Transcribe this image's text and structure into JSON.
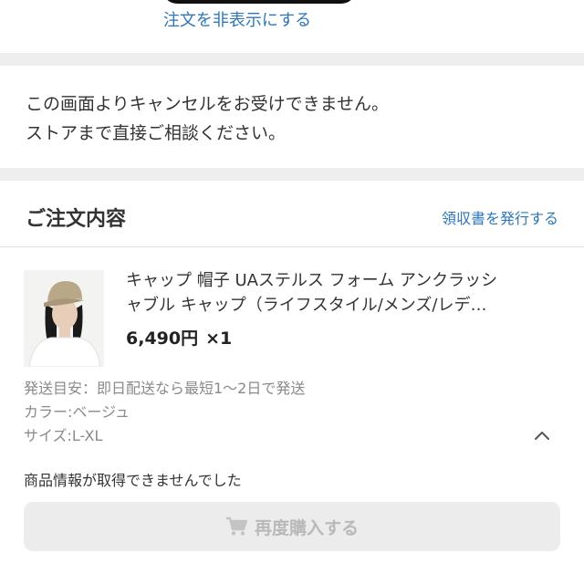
{
  "header": {
    "hide_order_link": "注文を非表示にする"
  },
  "notice": {
    "line1": "この画面よりキャンセルをお受けできません。",
    "line2": "ストアまで直接ご相談ください。"
  },
  "order": {
    "section_title": "ご注文内容",
    "receipt_link": "領収書を発行する",
    "item": {
      "name_line1": "キャップ 帽子 UAステルス フォーム アンクラッシ",
      "name_line2": "ャブル キャップ（ライフスタイル/メンズ/レデ…",
      "price": "6,490円",
      "quantity": "×1",
      "image_icon": "product-photo-cap",
      "shipping_estimate": "発送目安：即日配送なら最短1〜2日で発送",
      "color": "カラー:ベージュ",
      "size": "サイズ:L-XL"
    },
    "unavailable_message": "商品情報が取得できませんでした",
    "rebuy_button": "再度購入する",
    "collapse_icon": "chevron-up-icon",
    "cart_icon": "cart-icon"
  },
  "colors": {
    "link": "#2d77b8",
    "separator": "#eeeeee",
    "disabled_button_bg": "#ececec",
    "disabled_button_text": "#b9b9b9"
  }
}
